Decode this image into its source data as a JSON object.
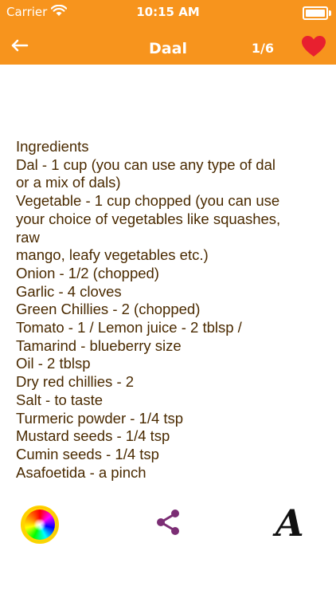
{
  "status_bar": {
    "carrier": "Carrier",
    "time": "10:15 AM"
  },
  "nav": {
    "title": "Daal",
    "counter": "1/6"
  },
  "colors": {
    "header": "#f7941d",
    "text": "#4a2a00",
    "heart": "#e8202f",
    "share": "#7b2d74"
  },
  "icons": {
    "back": "back-arrow-icon",
    "favorite": "heart-icon",
    "color": "color-wheel-icon",
    "share": "share-icon",
    "font": "font-icon"
  },
  "toolbar": {
    "font_label": "A"
  },
  "content": {
    "lines": [
      "Ingredients",
      "Dal - 1 cup (you can use any type of dal",
      "or a mix of dals)",
      "Vegetable - 1 cup chopped (you can use",
      "your choice of vegetables like squashes,",
      "raw",
      "mango, leafy vegetables etc.)",
      "Onion - 1/2 (chopped)",
      "Garlic - 4 cloves",
      "Green Chillies - 2 (chopped)",
      "Tomato - 1 / Lemon juice - 2 tblsp /",
      "Tamarind - blueberry size",
      "Oil - 2 tblsp",
      "Dry red chillies - 2",
      "Salt - to taste",
      "Turmeric powder - 1/4 tsp",
      "Mustard seeds - 1/4 tsp",
      "Cumin seeds - 1/4 tsp",
      "Asafoetida - a pinch"
    ]
  }
}
